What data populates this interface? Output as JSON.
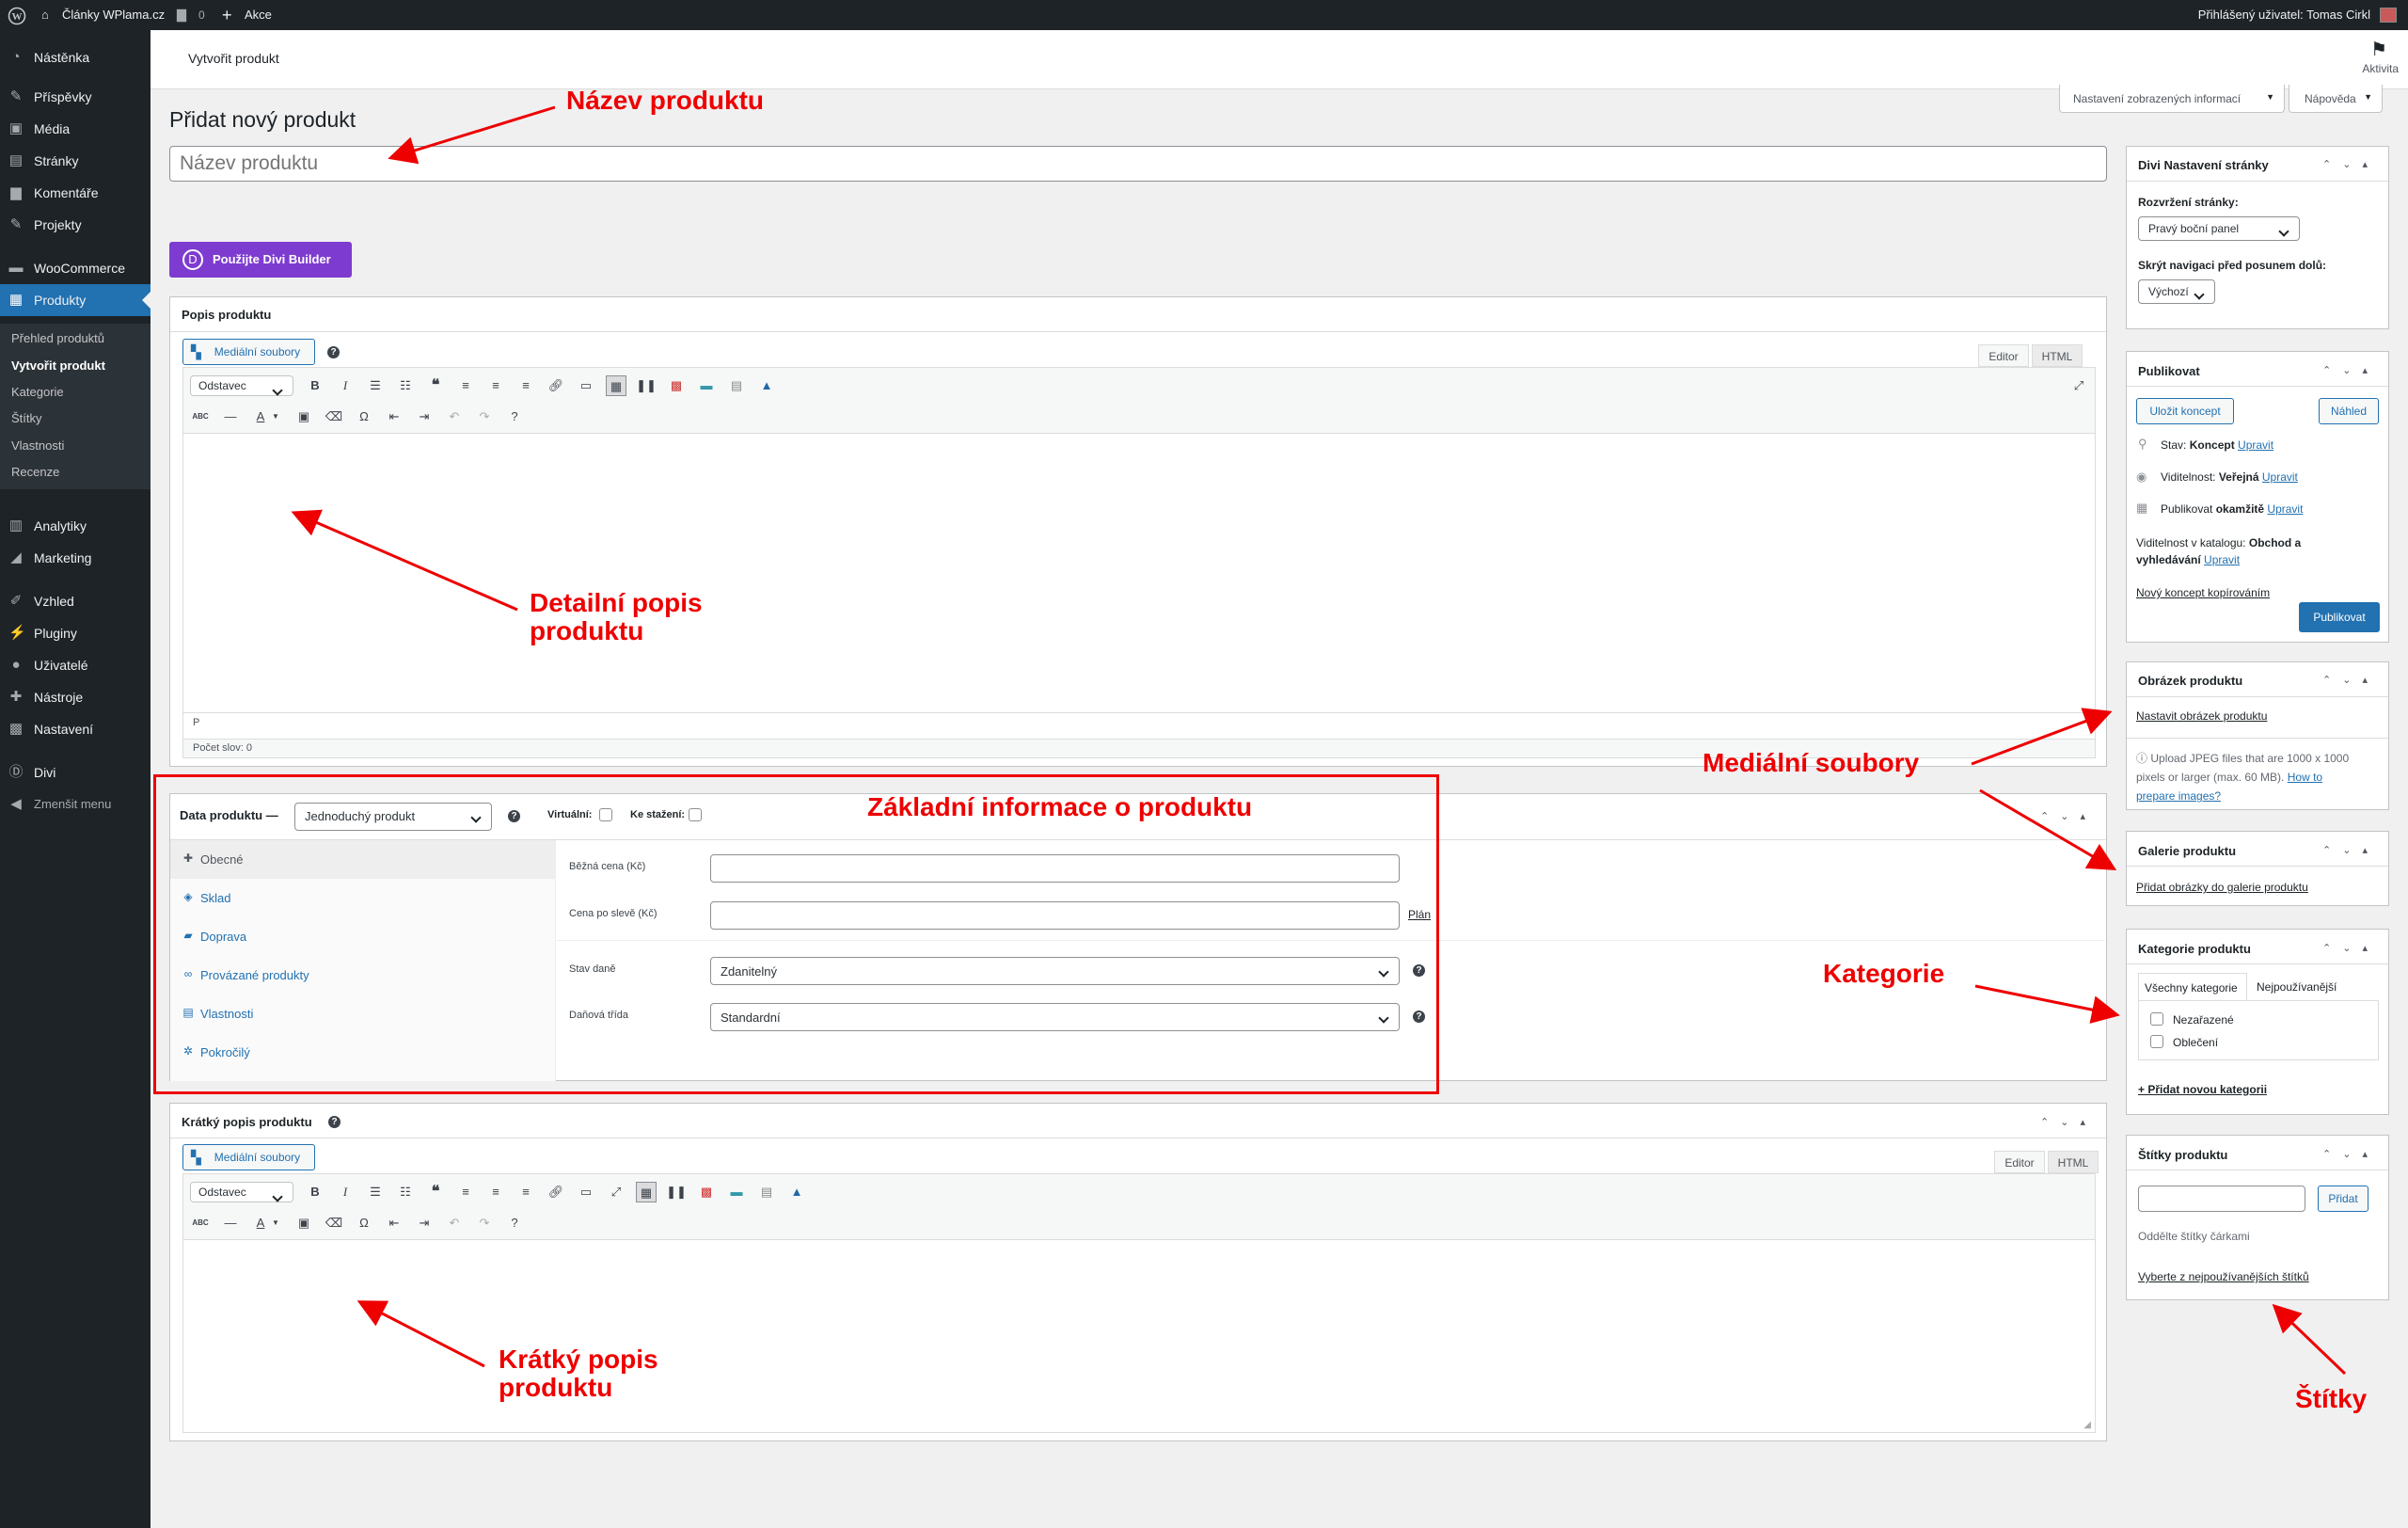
{
  "adminbar": {
    "site_name": "Články WPlama.cz",
    "comments_count": "0",
    "new_label": "Akce",
    "user_greeting": "Přihlášený uživatel: Tomas Cirkl"
  },
  "sidebar": {
    "items": [
      {
        "label": "Nástěnka"
      },
      {
        "label": "Příspěvky"
      },
      {
        "label": "Média"
      },
      {
        "label": "Stránky"
      },
      {
        "label": "Komentáře"
      },
      {
        "label": "Projekty"
      },
      {
        "label": "WooCommerce"
      },
      {
        "label": "Produkty"
      },
      {
        "label": "Analytiky"
      },
      {
        "label": "Marketing"
      },
      {
        "label": "Vzhled"
      },
      {
        "label": "Pluginy"
      },
      {
        "label": "Uživatelé"
      },
      {
        "label": "Nástroje"
      },
      {
        "label": "Nastavení"
      },
      {
        "label": "Divi"
      },
      {
        "label": "Zmenšit menu"
      }
    ],
    "submenu": [
      {
        "label": "Přehled produktů"
      },
      {
        "label": "Vytvořit produkt"
      },
      {
        "label": "Kategorie"
      },
      {
        "label": "Štítky"
      },
      {
        "label": "Vlastnosti"
      },
      {
        "label": "Recenze"
      }
    ]
  },
  "topbar": {
    "title": "Vytvořit produkt",
    "activity_label": "Aktivita"
  },
  "screen": {
    "options_label": "Nastavení zobrazených informací",
    "help_label": "Nápověda"
  },
  "page": {
    "heading": "Přidat nový produkt",
    "title_placeholder": "Název produktu",
    "divi_button": "Použijte Divi Builder"
  },
  "description": {
    "title": "Popis produktu",
    "media_button": "Mediální soubory",
    "tab_editor": "Editor",
    "tab_html": "HTML",
    "format_select": "Odstavec",
    "path": "P",
    "word_count": "Počet slov: 0"
  },
  "product_data": {
    "title": "Data produktu —",
    "type_select": "Jednoduchý produkt",
    "virtual_label": "Virtuální:",
    "download_label": "Ke stažení:",
    "tabs": [
      {
        "label": "Obecné"
      },
      {
        "label": "Sklad"
      },
      {
        "label": "Doprava"
      },
      {
        "label": "Provázané produkty"
      },
      {
        "label": "Vlastnosti"
      },
      {
        "label": "Pokročilý"
      }
    ],
    "regular_price_label": "Běžná cena (Kč)",
    "sale_price_label": "Cena po slevě (Kč)",
    "schedule_link": "Plán",
    "tax_status_label": "Stav daně",
    "tax_status_value": "Zdanitelný",
    "tax_class_label": "Daňová třída",
    "tax_class_value": "Standardní"
  },
  "short_description": {
    "title": "Krátký popis produktu",
    "media_button": "Mediální soubory",
    "tab_editor": "Editor",
    "tab_html": "HTML",
    "format_select": "Odstavec"
  },
  "divi_settings": {
    "title": "Divi Nastavení stránky",
    "layout_label": "Rozvržení stránky:",
    "layout_value": "Pravý boční panel",
    "nav_label": "Skrýt navigaci před posunem dolů:",
    "nav_value": "Výchozí"
  },
  "publish": {
    "title": "Publikovat",
    "save_draft": "Uložit koncept",
    "preview": "Náhled",
    "status_label": "Stav:",
    "status_value": "Koncept",
    "edit_link": "Upravit",
    "visibility_label": "Viditelnost:",
    "visibility_value": "Veřejná",
    "publish_label": "Publikovat",
    "publish_value": "okamžitě",
    "catalog_label": "Viditelnost v katalogu:",
    "catalog_value": "Obchod a vyhledávání",
    "copy_link": "Nový koncept kopírováním",
    "publish_button": "Publikovat"
  },
  "product_image": {
    "title": "Obrázek produktu",
    "set_link": "Nastavit obrázek produktu",
    "info": "Upload JPEG files that are 1000 x 1000 pixels or larger (max. 60 MB).",
    "info_link": "How to prepare images?"
  },
  "gallery": {
    "title": "Galerie produktu",
    "add_link": "Přidat obrázky do galerie produktu"
  },
  "categories": {
    "title": "Kategorie produktu",
    "tab_all": "Všechny kategorie",
    "tab_popular": "Nejpoužívanější",
    "items": [
      {
        "label": "Nezařazené"
      },
      {
        "label": "Oblečení"
      }
    ],
    "add_link": "+ Přidat novou kategorii"
  },
  "tags": {
    "title": "Štítky produktu",
    "add_button": "Přidat",
    "hint": "Oddělte štítky čárkami",
    "popular_link": "Vyberte z nejpoužívanějších štítků"
  },
  "annotations": {
    "name": "Název produktu",
    "detail": "Detailní popis produktu",
    "media": "Mediální soubory",
    "basic": "Základní informace o produktu",
    "category": "Kategorie",
    "short": "Krátký popis produktu",
    "tags": "Štítky"
  },
  "colors": {
    "accent": "#2271b1",
    "sidebar": "#1d2327",
    "divi": "#7e3bd0",
    "annotation": "#ee0000"
  }
}
